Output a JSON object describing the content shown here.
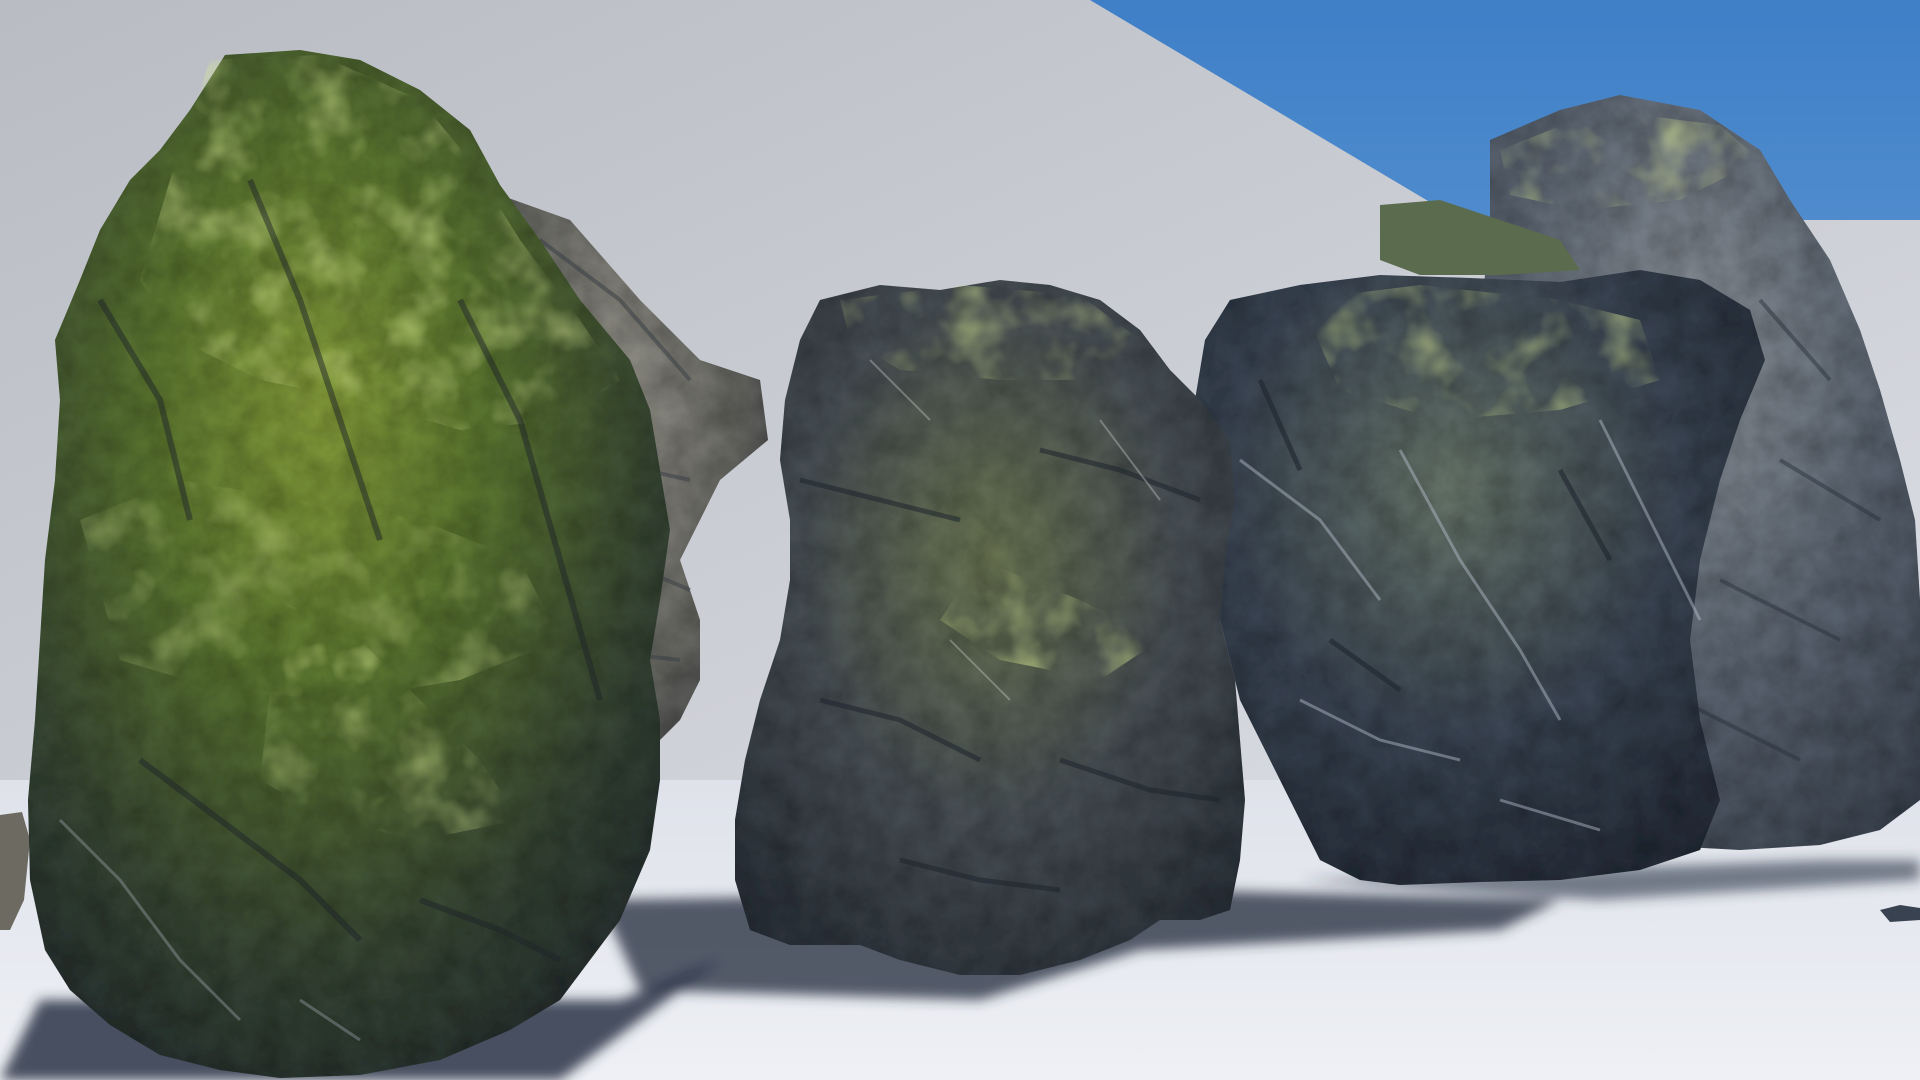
{
  "scene": {
    "colors": {
      "sky": "#3f7fc7",
      "sky_light": "#7fb0e0",
      "backdrop_wall": "#c4c6cc",
      "ground": "#e6e8ee",
      "shadow": "#2a3346",
      "rock_dark": "#2f3a46",
      "rock_mid": "#566271",
      "rock_light": "#8a8f92",
      "moss": "#8fb13a",
      "moss_bright": "#b5d35a"
    },
    "objects": [
      {
        "name": "rock-large-left-icon",
        "moss": "heavy"
      },
      {
        "name": "rock-behind-left-icon",
        "moss": "light"
      },
      {
        "name": "rock-center-icon",
        "moss": "medium"
      },
      {
        "name": "rock-right-front-icon",
        "moss": "medium"
      },
      {
        "name": "rock-right-back-icon",
        "moss": "light"
      }
    ]
  }
}
